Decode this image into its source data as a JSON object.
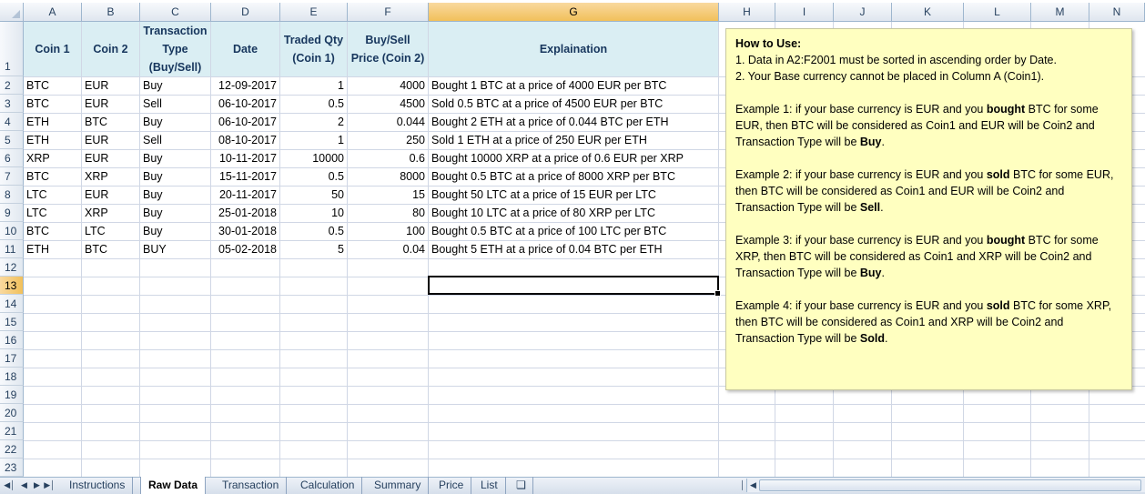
{
  "columns": [
    "A",
    "B",
    "C",
    "D",
    "E",
    "F",
    "G",
    "H",
    "I",
    "J",
    "K",
    "L",
    "M",
    "N"
  ],
  "rows": [
    "1",
    "2",
    "3",
    "4",
    "5",
    "6",
    "7",
    "8",
    "9",
    "10",
    "11",
    "12",
    "13",
    "14",
    "15",
    "16",
    "17",
    "18",
    "19",
    "20",
    "21",
    "22",
    "23"
  ],
  "headers": {
    "coin1": "Coin 1",
    "coin2": "Coin 2",
    "type_l1": "Transaction",
    "type_l2": "Type",
    "type_l3": "(Buy/Sell)",
    "date": "Date",
    "qty_l1": "Traded Qty",
    "qty_l2": "(Coin 1)",
    "price_l1": "Buy/Sell",
    "price_l2": "Price (Coin 2)",
    "explain": "Explaination"
  },
  "data_rows": [
    {
      "coin1": "BTC",
      "coin2": "EUR",
      "type": "Buy",
      "date": "12-09-2017",
      "qty": "1",
      "price": "4000",
      "explain": "Bought 1 BTC at a price of 4000 EUR per BTC"
    },
    {
      "coin1": "BTC",
      "coin2": "EUR",
      "type": "Sell",
      "date": "06-10-2017",
      "qty": "0.5",
      "price": "4500",
      "explain": "Sold 0.5 BTC at a price of 4500 EUR per BTC"
    },
    {
      "coin1": "ETH",
      "coin2": "BTC",
      "type": "Buy",
      "date": "06-10-2017",
      "qty": "2",
      "price": "0.044",
      "explain": "Bought 2 ETH at a price of 0.044 BTC per ETH"
    },
    {
      "coin1": "ETH",
      "coin2": "EUR",
      "type": "Sell",
      "date": "08-10-2017",
      "qty": "1",
      "price": "250",
      "explain": "Sold 1 ETH at a price of 250 EUR per ETH"
    },
    {
      "coin1": "XRP",
      "coin2": "EUR",
      "type": "Buy",
      "date": "10-11-2017",
      "qty": "10000",
      "price": "0.6",
      "explain": "Bought 10000 XRP at a price of 0.6 EUR per XRP"
    },
    {
      "coin1": "BTC",
      "coin2": "XRP",
      "type": "Buy",
      "date": "15-11-2017",
      "qty": "0.5",
      "price": "8000",
      "explain": "Bought 0.5 BTC at a price of 8000 XRP per BTC"
    },
    {
      "coin1": "LTC",
      "coin2": "EUR",
      "type": "Buy",
      "date": "20-11-2017",
      "qty": "50",
      "price": "15",
      "explain": "Bought 50 LTC at a price of 15 EUR per LTC"
    },
    {
      "coin1": "LTC",
      "coin2": "XRP",
      "type": "Buy",
      "date": "25-01-2018",
      "qty": "10",
      "price": "80",
      "explain": "Bought 10 LTC at a price of 80 XRP per LTC"
    },
    {
      "coin1": "BTC",
      "coin2": "LTC",
      "type": "Buy",
      "date": "30-01-2018",
      "qty": "0.5",
      "price": "100",
      "explain": "Bought 0.5 BTC at a price of 100 LTC per BTC"
    },
    {
      "coin1": "ETH",
      "coin2": "BTC",
      "type": "BUY",
      "date": "05-02-2018",
      "qty": "5",
      "price": "0.04",
      "explain": "Bought 5 ETH at a price of 0.04 BTC per ETH"
    }
  ],
  "note": {
    "title": "How to Use:",
    "item1": "1.  Data in A2:F2001  must be sorted in ascending order by Date.",
    "item2": "2.  Your Base currency cannot be placed in Column A (Coin1).",
    "ex1_a": "Example 1: if your base currency is EUR and you ",
    "ex1_b": "bought",
    "ex1_c": " BTC for some EUR, then BTC will be considered as Coin1  and EUR will be Coin2 and Transaction Type will be ",
    "ex1_d": "Buy",
    "ex2_a": "Example 2: if your base currency is EUR and you ",
    "ex2_b": "sold",
    "ex2_c": " BTC for some EUR, then BTC will be considered as Coin1  and EUR will be Coin2 and Transaction Type will be ",
    "ex2_d": "Sell",
    "ex3_a": "Example 3: if your base currency is EUR and you ",
    "ex3_b": "bought",
    "ex3_c": " BTC for some XRP, then BTC will be considered as Coin1 and XRP will be Coin2 and Transaction Type will be ",
    "ex3_d": "Buy",
    "ex4_a": "Example 4: if your base currency is EUR and you ",
    "ex4_b": "sold",
    "ex4_c": " BTC for some XRP, then BTC will be considered as Coin1 and XRP will be Coin2 and Transaction Type will be ",
    "ex4_d": "Sold",
    "period": "."
  },
  "sheet_tabs": [
    "Instructions",
    "Raw Data",
    "Transaction",
    "Calculation",
    "Summary",
    "Price",
    "List"
  ],
  "active_tab": "Raw Data",
  "colors": {
    "header_fill": "#daeef3",
    "header_text": "#17365d",
    "note_fill": "#ffffc0",
    "selected_header": "#f1c05a"
  }
}
